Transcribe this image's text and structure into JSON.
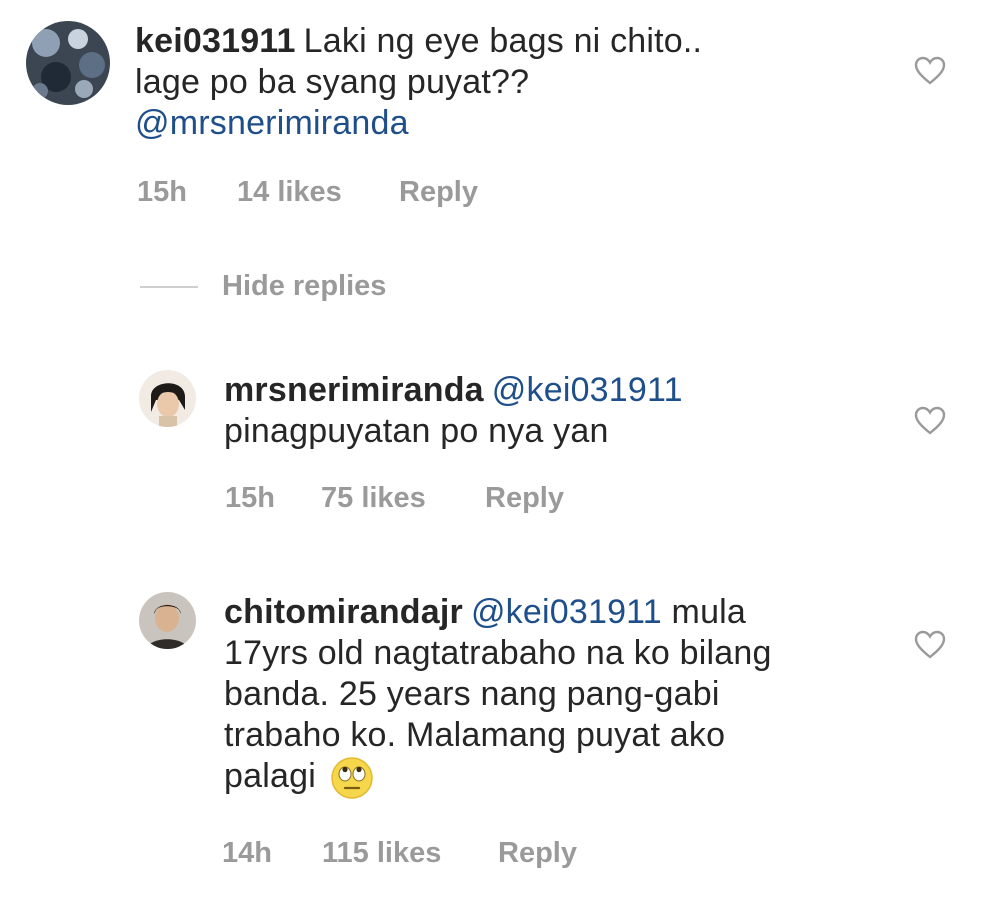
{
  "comments": [
    {
      "username": "kei031911",
      "text_lines": [
        "Laki ng eye bags ni chito..",
        "lage po ba syang puyat??"
      ],
      "mention": "@mrsnerimiranda",
      "time": "15h",
      "likes": "14 likes",
      "reply_label": "Reply",
      "avatar_icon": "avatar-photo-icon"
    }
  ],
  "hide_replies_label": "Hide replies",
  "replies": [
    {
      "username": "mrsnerimiranda",
      "mention": "@kei031911",
      "text_lines": [
        "pinagpuyatan po nya yan"
      ],
      "time": "15h",
      "likes": "75 likes",
      "reply_label": "Reply"
    },
    {
      "username": "chitomirandajr",
      "mention": "@kei031911",
      "first_line_tail": "mula",
      "text_lines": [
        "17yrs old nagtatrabaho na ko bilang",
        "banda. 25 years nang pang-gabi",
        "trabaho ko. Malamang puyat ako"
      ],
      "last_line": "palagi",
      "emoji": "rolling-eyes-emoji",
      "time": "14h",
      "likes": "115 likes",
      "reply_label": "Reply"
    }
  ],
  "colors": {
    "text": "#262626",
    "meta": "#9a9a9a",
    "mention": "#1f4f8a",
    "background": "#ffffff"
  }
}
